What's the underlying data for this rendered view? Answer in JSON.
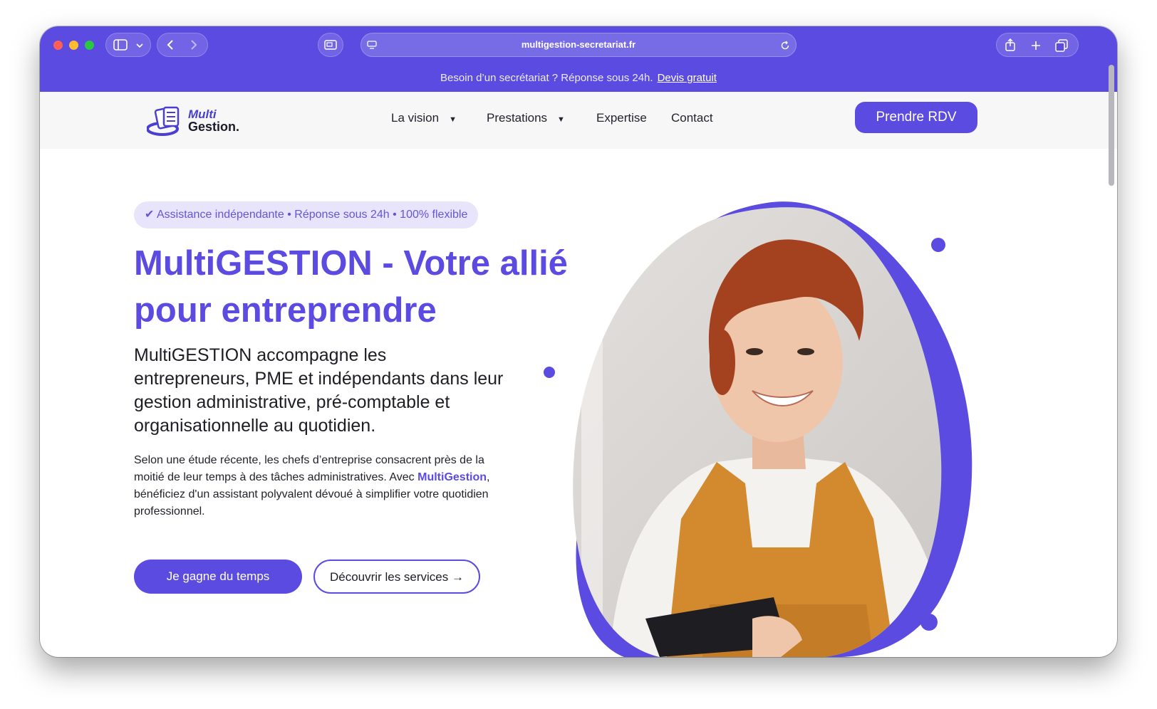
{
  "browser": {
    "url": "multigestion-secretariat.fr"
  },
  "announcement": {
    "text": "Besoin d’un secrétariat ? Réponse sous 24h.",
    "link": "Devis gratuit"
  },
  "nav": {
    "logo_line1": "Multi",
    "logo_line2": "Gestion.",
    "items": [
      {
        "label": "La vision",
        "has_dropdown": true
      },
      {
        "label": "Prestations",
        "has_dropdown": true
      },
      {
        "label": "Expertise",
        "has_dropdown": false
      },
      {
        "label": "Contact",
        "has_dropdown": false
      }
    ],
    "cta": "Prendre RDV"
  },
  "hero": {
    "badge": "✔ Assistance indépendante • Réponse sous 24h • 100% flexible",
    "title": "MultiGESTION - Votre allié pour entreprendre",
    "subtitle": "MultiGESTION accompagne les entrepreneurs, PME et indépendants dans leur gestion administrative, pré-comptable et organisationnelle au quotidien.",
    "body_part1": "Selon une étude récente, les chefs d’entreprise consacrent près de la moitié de leur temps à des tâches administratives. Avec ",
    "body_brand": "MultiGestion",
    "body_part2": ", bénéficiez d'un assistant polyvalent dévoué à simplifier votre quotidien professionnel.",
    "primary_button": "Je gagne du temps",
    "secondary_button": "Découvrir les services →"
  },
  "colors": {
    "brand": "#5b4be1",
    "badge_bg": "#e8e4fb",
    "text_dark": "#1d1d24"
  },
  "icons": [
    "sidebar-icon",
    "chevron-down-icon",
    "back-icon",
    "forward-icon",
    "tab-overview-icon",
    "site-settings-icon",
    "reload-icon",
    "share-icon",
    "new-tab-icon",
    "tabs-icon",
    "caret-down-icon"
  ]
}
